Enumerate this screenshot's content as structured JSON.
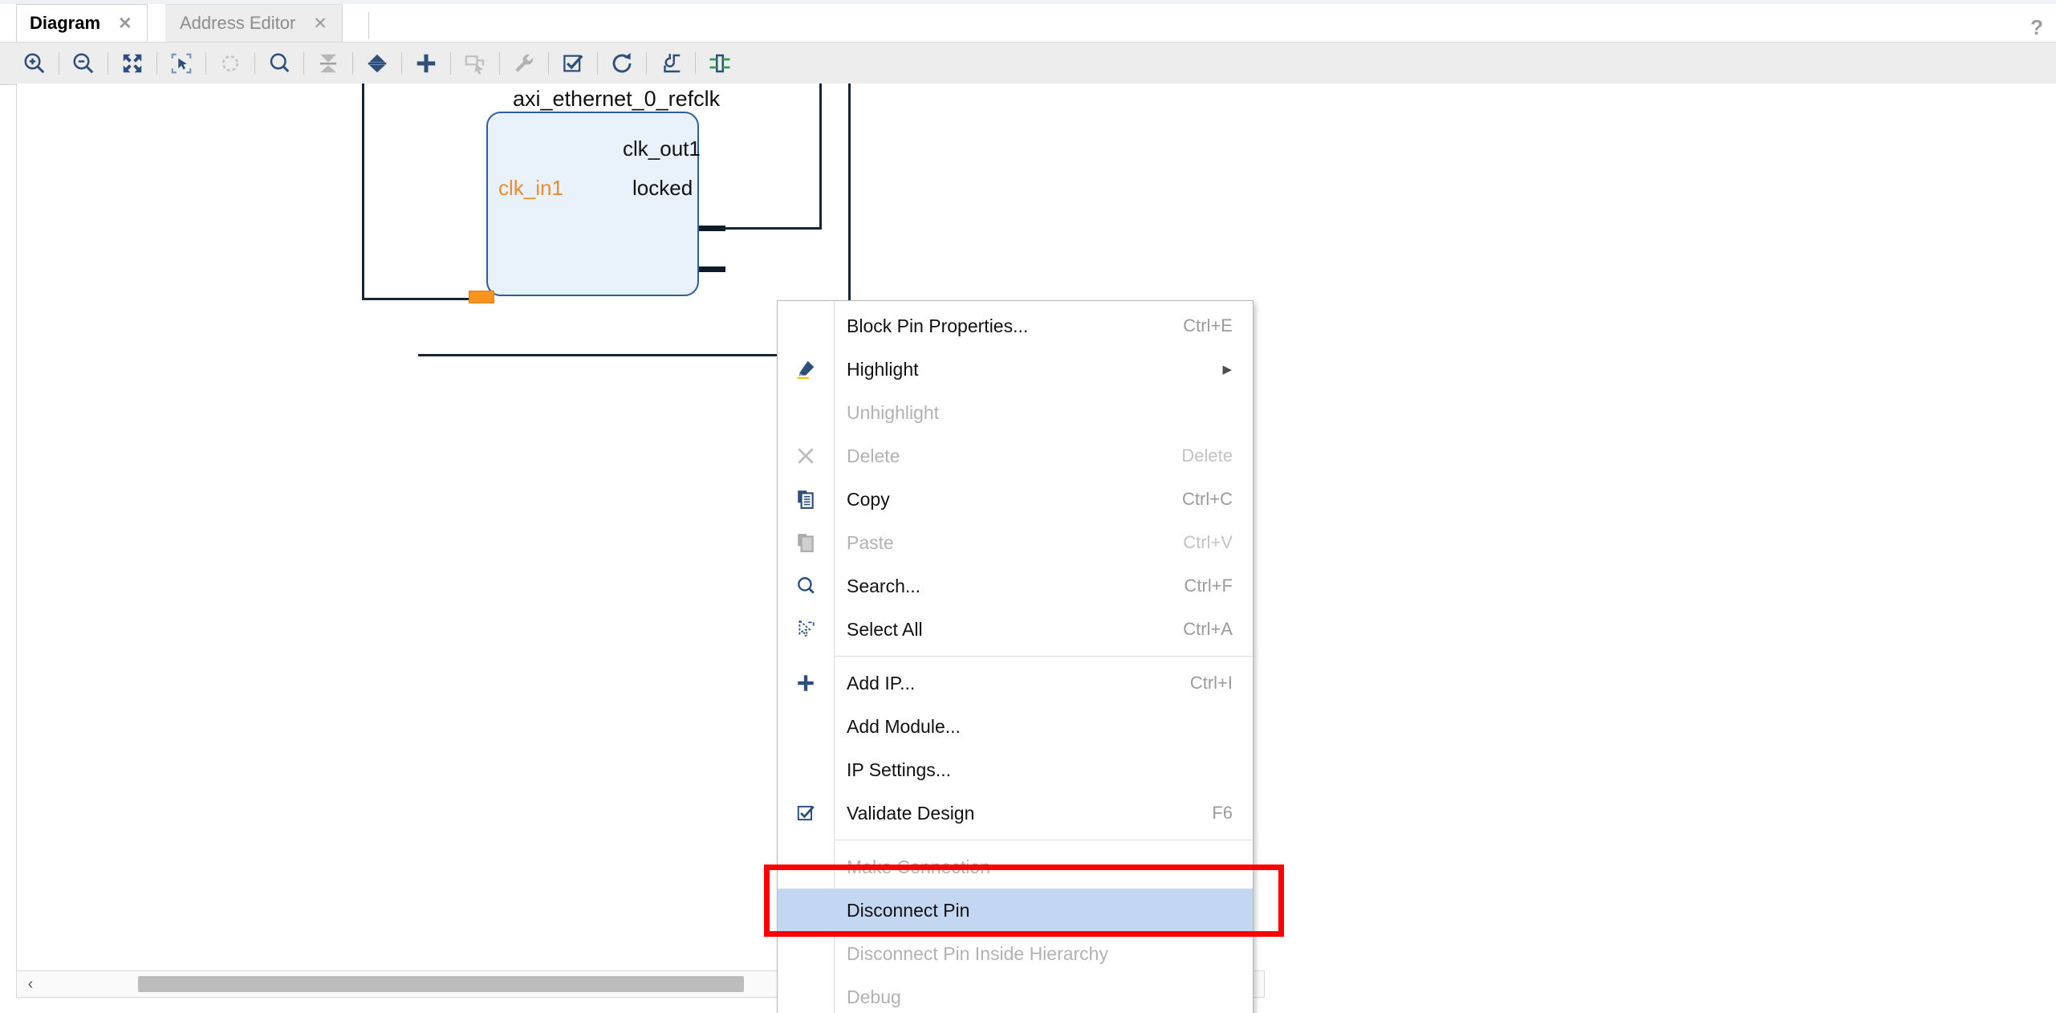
{
  "window": {
    "help_icon": "help-question-icon"
  },
  "tabs": [
    {
      "label": "Diagram",
      "active": true,
      "close_icon": "close-icon"
    },
    {
      "label": "Address Editor",
      "active": false,
      "close_icon": "close-icon"
    }
  ],
  "toolbar": {
    "buttons": [
      {
        "name": "zoom-in-icon",
        "tooltip": "Zoom In",
        "enabled": true
      },
      {
        "name": "zoom-out-icon",
        "tooltip": "Zoom Out",
        "enabled": true
      },
      {
        "name": "zoom-fit-icon",
        "tooltip": "Zoom Fit",
        "enabled": true
      },
      {
        "name": "zoom-area-icon",
        "tooltip": "Zoom Area",
        "enabled": true
      },
      {
        "name": "refocus-icon",
        "tooltip": "Refocus",
        "enabled": false
      },
      {
        "name": "search-icon",
        "tooltip": "Search",
        "enabled": true
      },
      {
        "name": "collapse-all-icon",
        "tooltip": "Collapse All",
        "enabled": false
      },
      {
        "name": "expand-all-icon",
        "tooltip": "Expand All",
        "enabled": true
      },
      {
        "name": "add-ip-icon",
        "tooltip": "Add IP",
        "enabled": true
      },
      {
        "name": "create-hierarchy-icon",
        "tooltip": "Create Hierarchy",
        "enabled": false
      },
      {
        "name": "wrench-settings-icon",
        "tooltip": "Settings",
        "enabled": false
      },
      {
        "name": "validate-design-icon",
        "tooltip": "Validate Design",
        "enabled": true
      },
      {
        "name": "regenerate-layout-icon",
        "tooltip": "Regenerate Layout",
        "enabled": true
      },
      {
        "name": "optimize-routing-icon",
        "tooltip": "Optimize Routing",
        "enabled": true
      },
      {
        "name": "show-interface-icon",
        "tooltip": "Show Interface",
        "enabled": true
      }
    ]
  },
  "diagram": {
    "block": {
      "title": "axi_ethernet_0_refclk",
      "input_pins": [
        {
          "label": "clk_in1",
          "selected": true
        }
      ],
      "output_pins": [
        {
          "label": "clk_out1",
          "selected": false
        },
        {
          "label": "locked",
          "selected": false
        }
      ]
    }
  },
  "context_menu": {
    "items": [
      {
        "label": "Block Pin Properties...",
        "shortcut": "Ctrl+E",
        "icon": null,
        "enabled": true,
        "highlighted": false,
        "separator_after": false,
        "submenu": false
      },
      {
        "label": "Highlight",
        "shortcut": "",
        "icon": "highlighter-icon",
        "enabled": true,
        "highlighted": false,
        "separator_after": false,
        "submenu": true
      },
      {
        "label": "Unhighlight",
        "shortcut": "",
        "icon": null,
        "enabled": false,
        "highlighted": false,
        "separator_after": false,
        "submenu": false
      },
      {
        "label": "Delete",
        "shortcut": "Delete",
        "icon": "delete-x-icon",
        "enabled": false,
        "highlighted": false,
        "separator_after": false,
        "submenu": false
      },
      {
        "label": "Copy",
        "shortcut": "Ctrl+C",
        "icon": "copy-icon",
        "enabled": true,
        "highlighted": false,
        "separator_after": false,
        "submenu": false
      },
      {
        "label": "Paste",
        "shortcut": "Ctrl+V",
        "icon": "paste-icon",
        "enabled": false,
        "highlighted": false,
        "separator_after": false,
        "submenu": false
      },
      {
        "label": "Search...",
        "shortcut": "Ctrl+F",
        "icon": "search-icon",
        "enabled": true,
        "highlighted": false,
        "separator_after": false,
        "submenu": false
      },
      {
        "label": "Select All",
        "shortcut": "Ctrl+A",
        "icon": "select-all-cursor-icon",
        "enabled": true,
        "highlighted": false,
        "separator_after": true,
        "submenu": false
      },
      {
        "label": "Add IP...",
        "shortcut": "Ctrl+I",
        "icon": "add-plus-icon",
        "enabled": true,
        "highlighted": false,
        "separator_after": false,
        "submenu": false
      },
      {
        "label": "Add Module...",
        "shortcut": "",
        "icon": null,
        "enabled": true,
        "highlighted": false,
        "separator_after": false,
        "submenu": false
      },
      {
        "label": "IP Settings...",
        "shortcut": "",
        "icon": null,
        "enabled": true,
        "highlighted": false,
        "separator_after": false,
        "submenu": false
      },
      {
        "label": "Validate Design",
        "shortcut": "F6",
        "icon": "validate-check-icon",
        "enabled": true,
        "highlighted": false,
        "separator_after": true,
        "submenu": false
      },
      {
        "label": "Make Connection",
        "shortcut": "",
        "icon": null,
        "enabled": false,
        "highlighted": false,
        "separator_after": false,
        "submenu": false
      },
      {
        "label": "Disconnect Pin",
        "shortcut": "",
        "icon": null,
        "enabled": true,
        "highlighted": true,
        "separator_after": false,
        "submenu": false
      },
      {
        "label": "Disconnect Pin Inside Hierarchy",
        "shortcut": "",
        "icon": null,
        "enabled": false,
        "highlighted": false,
        "separator_after": false,
        "submenu": false
      },
      {
        "label": "Debug",
        "shortcut": "",
        "icon": null,
        "enabled": false,
        "highlighted": false,
        "separator_after": false,
        "submenu": false
      }
    ]
  },
  "annotation": {
    "target_label": "Disconnect Pin",
    "color": "#ff0000"
  },
  "scrollbar": {
    "left_arrow": "‹"
  },
  "colors": {
    "block_fill": "#e9f1fb",
    "block_border": "#2a5f9e",
    "selected_pin": "#f7941e",
    "menu_highlight": "#c3d7f2",
    "wire": "#16263a",
    "toolbar_icon": "#2d4f7c",
    "annotation_red": "#ff0000"
  }
}
